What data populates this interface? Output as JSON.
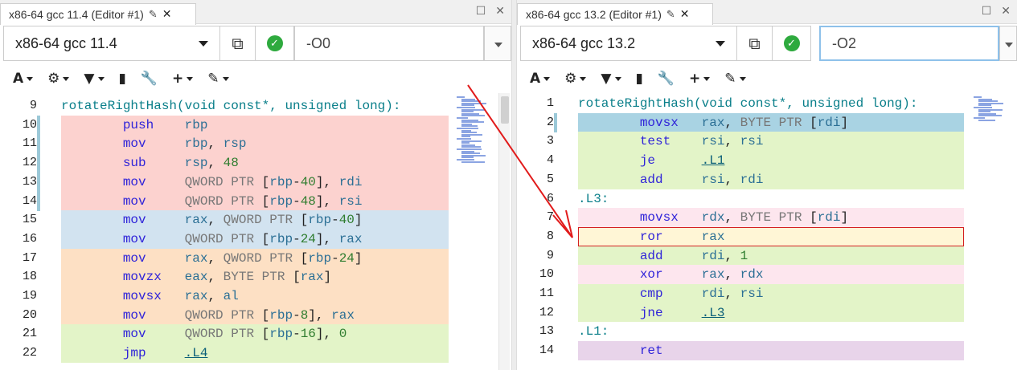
{
  "left": {
    "tab_title": "x86-64 gcc 11.4 (Editor #1)",
    "compiler": "x86-64 gcc 11.4",
    "options": "-O0",
    "lines": [
      {
        "n": "9",
        "bg": "#ffffff",
        "mark": "",
        "parts": [
          [
            "code",
            "rotateRightHash(void const*, unsigned long):"
          ]
        ]
      },
      {
        "n": "10",
        "bg": "#fcd2cf",
        "mark": "#9cc9d8",
        "parts": [
          [
            "sp",
            "        "
          ],
          [
            "mnemonic",
            "push"
          ],
          [
            "sp",
            "    "
          ],
          [
            "reg",
            "rbp"
          ]
        ]
      },
      {
        "n": "11",
        "bg": "#fcd2cf",
        "mark": "#9cc9d8",
        "parts": [
          [
            "sp",
            "        "
          ],
          [
            "mnemonic",
            "mov"
          ],
          [
            "sp",
            "     "
          ],
          [
            "reg",
            "rbp"
          ],
          [
            "dark",
            ", "
          ],
          [
            "reg",
            "rsp"
          ]
        ]
      },
      {
        "n": "12",
        "bg": "#fcd2cf",
        "mark": "#9cc9d8",
        "parts": [
          [
            "sp",
            "        "
          ],
          [
            "mnemonic",
            "sub"
          ],
          [
            "sp",
            "     "
          ],
          [
            "reg",
            "rsp"
          ],
          [
            "dark",
            ", "
          ],
          [
            "green",
            "48"
          ]
        ]
      },
      {
        "n": "13",
        "bg": "#fcd2cf",
        "mark": "#9cc9d8",
        "parts": [
          [
            "sp",
            "        "
          ],
          [
            "mnemonic",
            "mov"
          ],
          [
            "sp",
            "     "
          ],
          [
            "gray",
            "QWORD PTR "
          ],
          [
            "dark",
            "["
          ],
          [
            "reg",
            "rbp"
          ],
          [
            "dark",
            "-"
          ],
          [
            "green",
            "40"
          ],
          [
            "dark",
            "], "
          ],
          [
            "reg",
            "rdi"
          ]
        ]
      },
      {
        "n": "14",
        "bg": "#fcd2cf",
        "mark": "#9cc9d8",
        "parts": [
          [
            "sp",
            "        "
          ],
          [
            "mnemonic",
            "mov"
          ],
          [
            "sp",
            "     "
          ],
          [
            "gray",
            "QWORD PTR "
          ],
          [
            "dark",
            "["
          ],
          [
            "reg",
            "rbp"
          ],
          [
            "dark",
            "-"
          ],
          [
            "green",
            "48"
          ],
          [
            "dark",
            "], "
          ],
          [
            "reg",
            "rsi"
          ]
        ]
      },
      {
        "n": "15",
        "bg": "#d2e3f0",
        "mark": "",
        "parts": [
          [
            "sp",
            "        "
          ],
          [
            "mnemonic",
            "mov"
          ],
          [
            "sp",
            "     "
          ],
          [
            "reg",
            "rax"
          ],
          [
            "dark",
            ", "
          ],
          [
            "gray",
            "QWORD PTR "
          ],
          [
            "dark",
            "["
          ],
          [
            "reg",
            "rbp"
          ],
          [
            "dark",
            "-"
          ],
          [
            "green",
            "40"
          ],
          [
            "dark",
            "]"
          ]
        ]
      },
      {
        "n": "16",
        "bg": "#d2e3f0",
        "mark": "",
        "parts": [
          [
            "sp",
            "        "
          ],
          [
            "mnemonic",
            "mov"
          ],
          [
            "sp",
            "     "
          ],
          [
            "gray",
            "QWORD PTR "
          ],
          [
            "dark",
            "["
          ],
          [
            "reg",
            "rbp"
          ],
          [
            "dark",
            "-"
          ],
          [
            "green",
            "24"
          ],
          [
            "dark",
            "], "
          ],
          [
            "reg",
            "rax"
          ]
        ]
      },
      {
        "n": "17",
        "bg": "#fde0c4",
        "mark": "",
        "parts": [
          [
            "sp",
            "        "
          ],
          [
            "mnemonic",
            "mov"
          ],
          [
            "sp",
            "     "
          ],
          [
            "reg",
            "rax"
          ],
          [
            "dark",
            ", "
          ],
          [
            "gray",
            "QWORD PTR "
          ],
          [
            "dark",
            "["
          ],
          [
            "reg",
            "rbp"
          ],
          [
            "dark",
            "-"
          ],
          [
            "green",
            "24"
          ],
          [
            "dark",
            "]"
          ]
        ]
      },
      {
        "n": "18",
        "bg": "#fde0c4",
        "mark": "",
        "parts": [
          [
            "sp",
            "        "
          ],
          [
            "mnemonic",
            "movzx"
          ],
          [
            "sp",
            "   "
          ],
          [
            "reg",
            "eax"
          ],
          [
            "dark",
            ", "
          ],
          [
            "gray",
            "BYTE PTR "
          ],
          [
            "dark",
            "["
          ],
          [
            "reg",
            "rax"
          ],
          [
            "dark",
            "]"
          ]
        ]
      },
      {
        "n": "19",
        "bg": "#fde0c4",
        "mark": "",
        "parts": [
          [
            "sp",
            "        "
          ],
          [
            "mnemonic",
            "movsx"
          ],
          [
            "sp",
            "   "
          ],
          [
            "reg",
            "rax"
          ],
          [
            "dark",
            ", "
          ],
          [
            "reg",
            "al"
          ]
        ]
      },
      {
        "n": "20",
        "bg": "#fde0c4",
        "mark": "",
        "parts": [
          [
            "sp",
            "        "
          ],
          [
            "mnemonic",
            "mov"
          ],
          [
            "sp",
            "     "
          ],
          [
            "gray",
            "QWORD PTR "
          ],
          [
            "dark",
            "["
          ],
          [
            "reg",
            "rbp"
          ],
          [
            "dark",
            "-"
          ],
          [
            "green",
            "8"
          ],
          [
            "dark",
            "], "
          ],
          [
            "reg",
            "rax"
          ]
        ]
      },
      {
        "n": "21",
        "bg": "#e3f4c8",
        "mark": "",
        "parts": [
          [
            "sp",
            "        "
          ],
          [
            "mnemonic",
            "mov"
          ],
          [
            "sp",
            "     "
          ],
          [
            "gray",
            "QWORD PTR "
          ],
          [
            "dark",
            "["
          ],
          [
            "reg",
            "rbp"
          ],
          [
            "dark",
            "-"
          ],
          [
            "green",
            "16"
          ],
          [
            "dark",
            "], "
          ],
          [
            "green",
            "0"
          ]
        ]
      },
      {
        "n": "22",
        "bg": "#e3f4c8",
        "mark": "",
        "parts": [
          [
            "sp",
            "        "
          ],
          [
            "mnemonic",
            "jmp"
          ],
          [
            "sp",
            "     "
          ],
          [
            "label",
            ".L4"
          ]
        ]
      }
    ]
  },
  "right": {
    "tab_title": "x86-64 gcc 13.2 (Editor #1)",
    "compiler": "x86-64 gcc 13.2",
    "options": "-O2",
    "lines": [
      {
        "n": "1",
        "bg": "#ffffff",
        "mark": "",
        "parts": [
          [
            "code",
            "rotateRightHash(void const*, unsigned long):"
          ]
        ]
      },
      {
        "n": "2",
        "bg": "#a9d3e3",
        "mark": "#9cc9d8",
        "parts": [
          [
            "sp",
            "        "
          ],
          [
            "mnemonic",
            "movsx"
          ],
          [
            "sp",
            "   "
          ],
          [
            "reg",
            "rax"
          ],
          [
            "dark",
            ", "
          ],
          [
            "gray",
            "BYTE PTR "
          ],
          [
            "dark",
            "["
          ],
          [
            "reg",
            "rdi"
          ],
          [
            "dark",
            "]"
          ]
        ]
      },
      {
        "n": "3",
        "bg": "#e3f4c8",
        "mark": "",
        "parts": [
          [
            "sp",
            "        "
          ],
          [
            "mnemonic",
            "test"
          ],
          [
            "sp",
            "    "
          ],
          [
            "reg",
            "rsi"
          ],
          [
            "dark",
            ", "
          ],
          [
            "reg",
            "rsi"
          ]
        ]
      },
      {
        "n": "4",
        "bg": "#e3f4c8",
        "mark": "",
        "parts": [
          [
            "sp",
            "        "
          ],
          [
            "mnemonic",
            "je"
          ],
          [
            "sp",
            "      "
          ],
          [
            "label",
            ".L1"
          ]
        ]
      },
      {
        "n": "5",
        "bg": "#e3f4c8",
        "mark": "",
        "parts": [
          [
            "sp",
            "        "
          ],
          [
            "mnemonic",
            "add"
          ],
          [
            "sp",
            "     "
          ],
          [
            "reg",
            "rsi"
          ],
          [
            "dark",
            ", "
          ],
          [
            "reg",
            "rdi"
          ]
        ]
      },
      {
        "n": "6",
        "bg": "#ffffff",
        "mark": "",
        "parts": [
          [
            "code",
            ".L3:"
          ]
        ]
      },
      {
        "n": "7",
        "bg": "#fde6ee",
        "mark": "",
        "parts": [
          [
            "sp",
            "        "
          ],
          [
            "mnemonic",
            "movsx"
          ],
          [
            "sp",
            "   "
          ],
          [
            "reg",
            "rdx"
          ],
          [
            "dark",
            ", "
          ],
          [
            "gray",
            "BYTE PTR "
          ],
          [
            "dark",
            "["
          ],
          [
            "reg",
            "rdi"
          ],
          [
            "dark",
            "]"
          ]
        ]
      },
      {
        "n": "8",
        "bg": "#fff6d6",
        "mark": "",
        "box": true,
        "parts": [
          [
            "sp",
            "        "
          ],
          [
            "mnemonic",
            "ror"
          ],
          [
            "sp",
            "     "
          ],
          [
            "reg",
            "rax"
          ]
        ]
      },
      {
        "n": "9",
        "bg": "#e3f4c8",
        "mark": "",
        "parts": [
          [
            "sp",
            "        "
          ],
          [
            "mnemonic",
            "add"
          ],
          [
            "sp",
            "     "
          ],
          [
            "reg",
            "rdi"
          ],
          [
            "dark",
            ", "
          ],
          [
            "green",
            "1"
          ]
        ]
      },
      {
        "n": "10",
        "bg": "#fde6ee",
        "mark": "",
        "parts": [
          [
            "sp",
            "        "
          ],
          [
            "mnemonic",
            "xor"
          ],
          [
            "sp",
            "     "
          ],
          [
            "reg",
            "rax"
          ],
          [
            "dark",
            ", "
          ],
          [
            "reg",
            "rdx"
          ]
        ]
      },
      {
        "n": "11",
        "bg": "#e3f4c8",
        "mark": "",
        "parts": [
          [
            "sp",
            "        "
          ],
          [
            "mnemonic",
            "cmp"
          ],
          [
            "sp",
            "     "
          ],
          [
            "reg",
            "rdi"
          ],
          [
            "dark",
            ", "
          ],
          [
            "reg",
            "rsi"
          ]
        ]
      },
      {
        "n": "12",
        "bg": "#e3f4c8",
        "mark": "",
        "parts": [
          [
            "sp",
            "        "
          ],
          [
            "mnemonic",
            "jne"
          ],
          [
            "sp",
            "     "
          ],
          [
            "label",
            ".L3"
          ]
        ]
      },
      {
        "n": "13",
        "bg": "#ffffff",
        "mark": "",
        "parts": [
          [
            "code",
            ".L1:"
          ]
        ]
      },
      {
        "n": "14",
        "bg": "#e8d4ea",
        "mark": "",
        "parts": [
          [
            "sp",
            "        "
          ],
          [
            "mnemonic",
            "ret"
          ]
        ]
      }
    ]
  },
  "toolbar_icons": [
    "font-icon",
    "gear-icon",
    "filter-icon",
    "book-icon",
    "wrench-icon",
    "plus-icon",
    "brush-icon"
  ],
  "toolbar_glyphs": {
    "font": "A",
    "gear": "⚙",
    "filter": "▼",
    "book": "▮",
    "wrench": "🔧",
    "plus": "+",
    "brush": "✎"
  },
  "tab_glyphs": {
    "edit": "✎",
    "close": "✕",
    "maximize": "☐",
    "window_close": "✕",
    "popout": "⧉",
    "check": "✓"
  },
  "colors": {
    "accent_arrow": "#e11b1b",
    "status_ok": "#2eaa3e"
  }
}
